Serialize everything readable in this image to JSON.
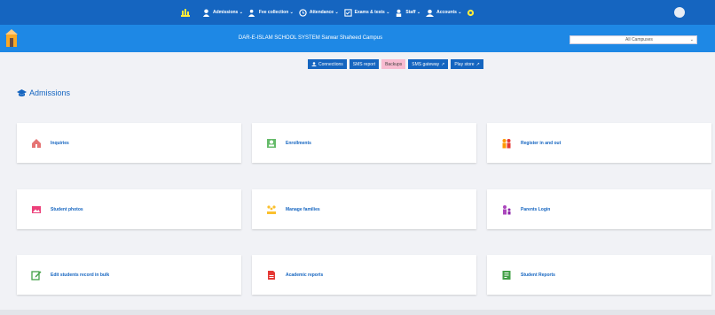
{
  "topbar": {
    "nav_items": [
      {
        "label": "Admissions ⌄",
        "icon": "user-tie-icon"
      },
      {
        "label": "Fee collection ⌄",
        "icon": "users-icon"
      },
      {
        "label": "Attendance ⌄",
        "icon": "clock-icon"
      },
      {
        "label": "Exams & tests ⌄",
        "icon": "checklist-icon"
      },
      {
        "label": "Staff ⌄",
        "icon": "staff-icon"
      },
      {
        "label": "Accounts ⌄",
        "icon": "accounts-icon"
      }
    ],
    "colors": {
      "primary": "#1565c0",
      "secondary": "#1e88e5"
    }
  },
  "subbar": {
    "school_name": "DAR-E-ISLAM SCHOOL SYSTEM Sarwar Shaheed Campus",
    "campus_select": "All Campuses"
  },
  "action_buttons": [
    {
      "label": "Connections",
      "icon": "users-icon",
      "style": "blue"
    },
    {
      "label": "SMS report",
      "icon": "",
      "style": "blue"
    },
    {
      "label": "Backups",
      "icon": "",
      "style": "pink"
    },
    {
      "label": "SMS gateway",
      "icon": "external-link-icon",
      "style": "blue"
    },
    {
      "label": "Play store",
      "icon": "external-link-icon",
      "style": "blue"
    }
  ],
  "page": {
    "title": "Admissions"
  },
  "cards": [
    {
      "label": "Inquiries",
      "icon": "inquiry-house-icon"
    },
    {
      "label": "Enrollments",
      "icon": "enrollment-icon"
    },
    {
      "label": "Register in and out",
      "icon": "register-people-icon"
    },
    {
      "label": "Student photos",
      "icon": "photo-icon"
    },
    {
      "label": "Manage families",
      "icon": "family-icon"
    },
    {
      "label": "Parents Login",
      "icon": "parent-login-icon"
    },
    {
      "label": "Edit students record in bulk",
      "icon": "edit-icon"
    },
    {
      "label": "Academic reports",
      "icon": "pdf-report-icon"
    },
    {
      "label": "Student Reports",
      "icon": "student-report-icon"
    }
  ]
}
